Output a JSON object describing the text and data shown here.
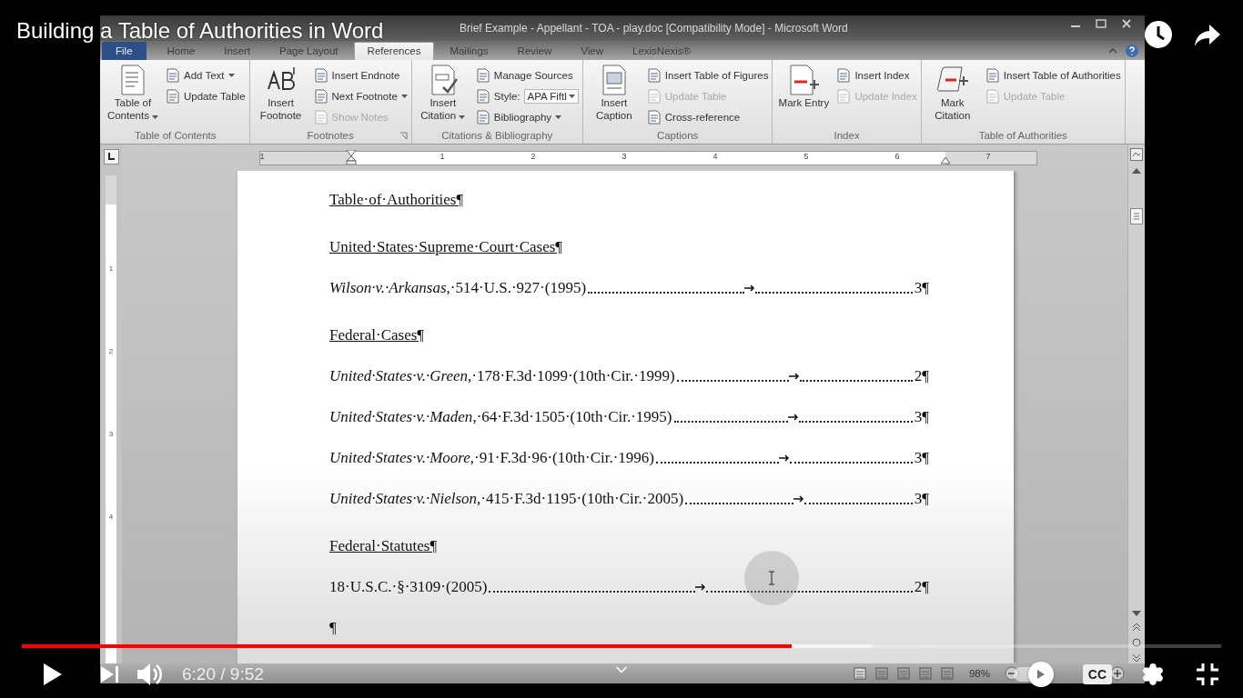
{
  "player": {
    "title": "Building a Table of Authorities in Word",
    "progress": {
      "level": 0.642
    },
    "buffer": {
      "level": 0.709
    },
    "time": "6:20 / 9:52",
    "autoplay": {
      "on": true
    },
    "captions": "CC"
  },
  "word": {
    "title": "Brief Example - Appellant - TOA - play.doc [Compatibility Mode] - Microsoft Word",
    "tabs": [
      {
        "label": "File",
        "kind": "file",
        "selected": false
      },
      {
        "label": "Home",
        "kind": "tab",
        "selected": false
      },
      {
        "label": "Insert",
        "kind": "tab",
        "selected": false
      },
      {
        "label": "Page Layout",
        "kind": "tab",
        "selected": false
      },
      {
        "label": "References",
        "kind": "tab",
        "selected": true
      },
      {
        "label": "Mailings",
        "kind": "tab",
        "selected": false
      },
      {
        "label": "Review",
        "kind": "tab",
        "selected": false
      },
      {
        "label": "View",
        "kind": "tab",
        "selected": false
      },
      {
        "label": "LexisNexis®",
        "kind": "tab",
        "selected": false
      }
    ],
    "groups": [
      {
        "name": "Table of Contents",
        "launcher": false,
        "large": {
          "label": "Table of Contents",
          "dropdown": true
        },
        "items": [
          {
            "kind": "button",
            "label": "Add Text",
            "dropdown": true,
            "disabled": false
          },
          {
            "kind": "button",
            "label": "Update Table",
            "dropdown": false,
            "disabled": false
          }
        ]
      },
      {
        "name": "Footnotes",
        "launcher": true,
        "large": {
          "label": "Insert Footnote",
          "dropdown": false
        },
        "items": [
          {
            "kind": "button",
            "label": "Insert Endnote",
            "dropdown": false,
            "disabled": false
          },
          {
            "kind": "button",
            "label": "Next Footnote",
            "dropdown": true,
            "disabled": false
          },
          {
            "kind": "button",
            "label": "Show Notes",
            "dropdown": false,
            "disabled": true
          }
        ]
      },
      {
        "name": "Citations & Bibliography",
        "launcher": false,
        "large": {
          "label": "Insert Citation",
          "dropdown": true
        },
        "items": [
          {
            "kind": "button",
            "label": "Manage Sources",
            "dropdown": false,
            "disabled": false
          },
          {
            "kind": "style",
            "label": "Style:",
            "value": "APA Fiftl",
            "disabled": false
          },
          {
            "kind": "button",
            "label": "Bibliography",
            "dropdown": true,
            "disabled": false
          }
        ]
      },
      {
        "name": "Captions",
        "launcher": false,
        "large": {
          "label": "Insert Caption",
          "dropdown": false
        },
        "items": [
          {
            "kind": "button",
            "label": "Insert Table of Figures",
            "dropdown": false,
            "disabled": false
          },
          {
            "kind": "button",
            "label": "Update Table",
            "dropdown": false,
            "disabled": true
          },
          {
            "kind": "button",
            "label": "Cross-reference",
            "dropdown": false,
            "disabled": false
          }
        ]
      },
      {
        "name": "Index",
        "launcher": false,
        "large": {
          "label": "Mark Entry",
          "dropdown": false
        },
        "items": [
          {
            "kind": "button",
            "label": "Insert Index",
            "dropdown": false,
            "disabled": false
          },
          {
            "kind": "button",
            "label": "Update Index",
            "dropdown": false,
            "disabled": true
          }
        ]
      },
      {
        "name": "Table of Authorities",
        "launcher": false,
        "large": {
          "label": "Mark Citation",
          "dropdown": false
        },
        "items": [
          {
            "kind": "button",
            "label": "Insert Table of Authorities",
            "dropdown": false,
            "disabled": false
          },
          {
            "kind": "button",
            "label": "Update Table",
            "dropdown": false,
            "disabled": true
          }
        ]
      }
    ],
    "ruler_numbers": [
      "1",
      "1",
      "2",
      "3",
      "4",
      "5",
      "6",
      "7"
    ],
    "vertical_ruler_numbers": [
      "1",
      "2",
      "3",
      "4"
    ],
    "document": [
      {
        "kind": "heading",
        "text": "Table·of·Authorities¶"
      },
      {
        "kind": "heading",
        "text": "United·States·Supreme·Court·Cases¶"
      },
      {
        "kind": "entry",
        "text": "*Wilson·v.·Arkansas*,·514·U.S.·927·(1995)",
        "page": "3¶"
      },
      {
        "kind": "heading",
        "text": "Federal·Cases¶"
      },
      {
        "kind": "entry",
        "text": "*United·States·v.·Green*,·178·F.3d·1099·(10th·Cir.·1999)",
        "page": "2¶"
      },
      {
        "kind": "entry",
        "text": "*United·States·v.·Maden*,·64·F.3d·1505·(10th·Cir.·1995)",
        "page": "3¶"
      },
      {
        "kind": "entry",
        "text": "*United·States·v.·Moore*,·91·F.3d·96·(10th·Cir.·1996)",
        "page": "3¶"
      },
      {
        "kind": "entry",
        "text": "*United·States·v.·Nielson*,·415·F.3d·1195·(10th·Cir.·2005)",
        "page": "3¶"
      },
      {
        "kind": "heading",
        "text": "Federal·Statutes¶"
      },
      {
        "kind": "entry",
        "text": "18·U.S.C.·§·3109·(2005)",
        "page": "2¶"
      },
      {
        "kind": "empty",
        "text": "¶"
      }
    ],
    "status_bar": {
      "zoom": "98%"
    }
  }
}
